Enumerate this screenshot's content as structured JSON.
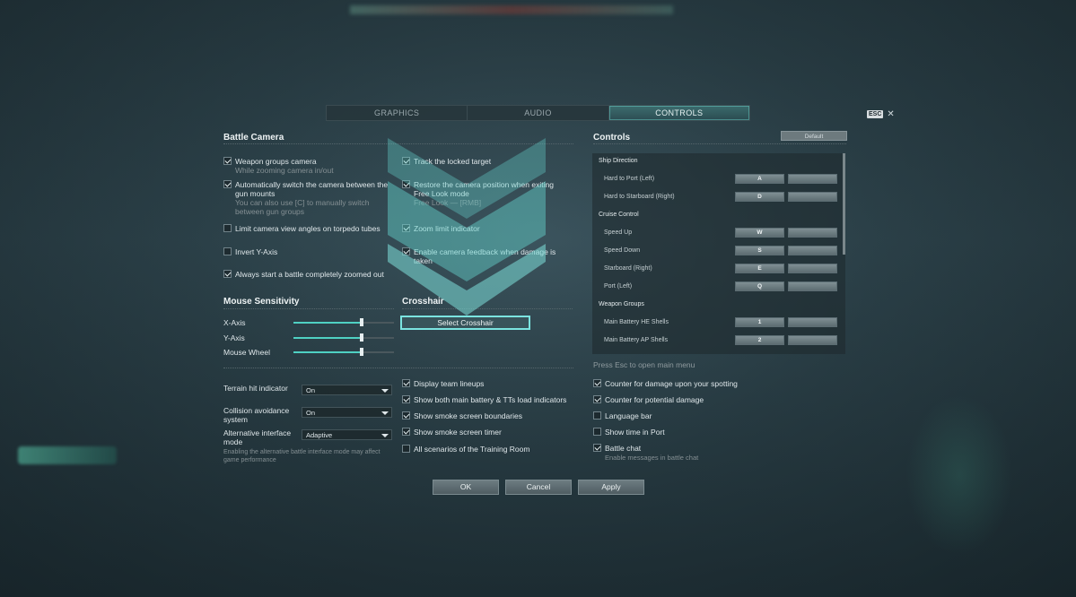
{
  "tabs": [
    "GRAPHICS",
    "AUDIO",
    "CONTROLS"
  ],
  "esc_key": "ESC",
  "battle_camera": {
    "title": "Battle Camera",
    "left": [
      {
        "label": "Weapon groups camera",
        "sub": "While zooming camera in/out",
        "checked": true
      },
      {
        "label": "Automatically switch the camera between the gun mounts",
        "sub": "You can also use [C] to manually switch between gun groups",
        "checked": true
      },
      {
        "label": "Limit camera view angles on torpedo tubes",
        "sub": "",
        "checked": false
      },
      {
        "label": "Invert Y-Axis",
        "sub": "",
        "checked": false
      },
      {
        "label": "Always start a battle completely zoomed out",
        "sub": "",
        "checked": true
      }
    ],
    "right": [
      {
        "label": "Track the locked target",
        "sub": "",
        "checked": true
      },
      {
        "label": "Restore the camera position when exiting Free Look mode",
        "sub": "Free Look — [RMB]",
        "checked": true
      },
      {
        "label": "Zoom limit indicator",
        "sub": "",
        "checked": true
      },
      {
        "label": "Enable camera feedback when damage is taken",
        "sub": "",
        "checked": true
      }
    ]
  },
  "mouse_sensitivity": {
    "title": "Mouse Sensitivity",
    "sliders": [
      {
        "label": "X-Axis",
        "value": 0.68
      },
      {
        "label": "Y-Axis",
        "value": 0.68
      },
      {
        "label": "Mouse Wheel",
        "value": 0.68
      }
    ]
  },
  "crosshair": {
    "title": "Crosshair",
    "button": "Select Crosshair"
  },
  "dropdowns": [
    {
      "label": "Terrain hit indicator",
      "value": "On",
      "sub": ""
    },
    {
      "label": "Collision avoidance system",
      "value": "On",
      "sub": ""
    },
    {
      "label": "Alternative interface mode",
      "value": "Adaptive",
      "sub": "Enabling the alternative battle interface mode may affect game performance"
    }
  ],
  "mid_checks": [
    {
      "label": "Display team lineups",
      "checked": true
    },
    {
      "label": "Show both main battery & TTs load indicators",
      "checked": true
    },
    {
      "label": "Show smoke screen boundaries",
      "checked": true
    },
    {
      "label": "Show smoke screen timer",
      "checked": true
    },
    {
      "label": "All scenarios of the Training Room",
      "checked": false
    }
  ],
  "controls": {
    "title": "Controls",
    "default_button": "Default",
    "rows": [
      {
        "type": "cat",
        "label": "Ship Direction"
      },
      {
        "type": "act",
        "label": "Hard to Port (Left)",
        "key": "A"
      },
      {
        "type": "act",
        "label": "Hard to Starboard (Right)",
        "key": "D"
      },
      {
        "type": "cat",
        "label": "Cruise Control"
      },
      {
        "type": "act",
        "label": "Speed Up",
        "key": "W"
      },
      {
        "type": "act",
        "label": "Speed Down",
        "key": "S"
      },
      {
        "type": "act",
        "label": "Starboard (Right)",
        "key": "E"
      },
      {
        "type": "act",
        "label": "Port (Left)",
        "key": "Q"
      },
      {
        "type": "cat",
        "label": "Weapon Groups"
      },
      {
        "type": "act",
        "label": "Main Battery HE Shells",
        "key": "1"
      },
      {
        "type": "act",
        "label": "Main Battery AP Shells",
        "key": "2"
      }
    ],
    "press_esc": "Press Esc to open main menu"
  },
  "right_checks": [
    {
      "label": "Counter for damage upon your spotting",
      "checked": true,
      "sub": ""
    },
    {
      "label": "Counter for potential damage",
      "checked": true,
      "sub": ""
    },
    {
      "label": "Language bar",
      "checked": false,
      "sub": ""
    },
    {
      "label": "Show time in Port",
      "checked": false,
      "sub": ""
    },
    {
      "label": "Battle chat",
      "checked": true,
      "sub": "Enable messages in battle chat"
    }
  ],
  "footer": {
    "ok": "OK",
    "cancel": "Cancel",
    "apply": "Apply"
  },
  "colors": {
    "accent": "#4fd1c3",
    "chevron": "#67d6d0"
  }
}
